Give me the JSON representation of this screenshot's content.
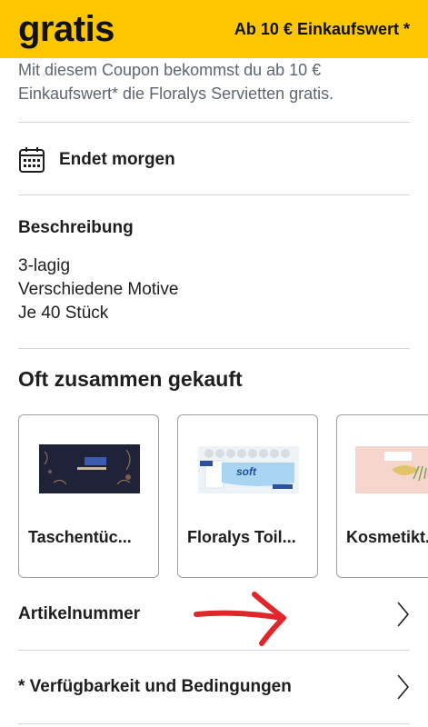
{
  "banner": {
    "title": "gratis",
    "value": "Ab 10 € Einkaufswert *",
    "color": "#fcc600"
  },
  "coupon": {
    "line1": "Mit diesem Coupon bekommst du ab 10 €",
    "line2": "Einkaufswert* die Floralys Servietten gratis."
  },
  "expiry": {
    "icon": "calendar-icon",
    "text": "Endet morgen"
  },
  "description": {
    "title": "Beschreibung",
    "lines": [
      "3-lagig",
      "Verschiedene Motive",
      "Je 40 Stück"
    ]
  },
  "related": {
    "title": "Oft zusammen gekauft",
    "products": [
      {
        "name": "Taschentüc...",
        "image": "tissue-box-dark"
      },
      {
        "name": "Floralys Toil...",
        "image": "toilet-paper-pack"
      },
      {
        "name": "Kosmetikt...",
        "image": "cosmetic-tissue-box"
      }
    ]
  },
  "links": [
    {
      "label": "Artikelnummer",
      "icon": "chevron-right-icon"
    },
    {
      "label": "* Verfügbarkeit und Bedingungen",
      "icon": "chevron-right-icon"
    }
  ],
  "annotation": {
    "type": "red-arrow",
    "color": "#e0262b"
  }
}
